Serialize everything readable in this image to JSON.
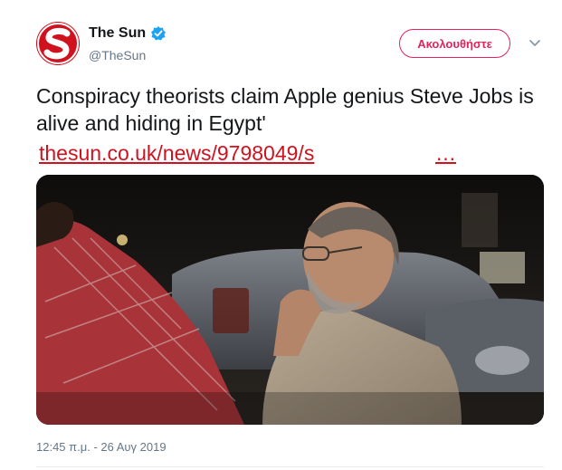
{
  "user": {
    "display_name": "The Sun",
    "handle": "@TheSun",
    "verified": true,
    "avatar_icon": "the-sun-logo",
    "brand_color": "#d0121e"
  },
  "actions": {
    "follow_label": "Ακολουθήστε",
    "accent_color": "#e0245e",
    "menu_icon": "chevron-down-icon"
  },
  "tweet": {
    "text": "Conspiracy theorists claim Apple genius Steve Jobs is alive and hiding in Egypt'",
    "link_text": "thesun.co.uk/news/9798049/s",
    "link_ellipsis": "…",
    "media_description_icon": "photo",
    "timestamp": "12:45 π.μ. - 26 Αυγ 2019"
  }
}
